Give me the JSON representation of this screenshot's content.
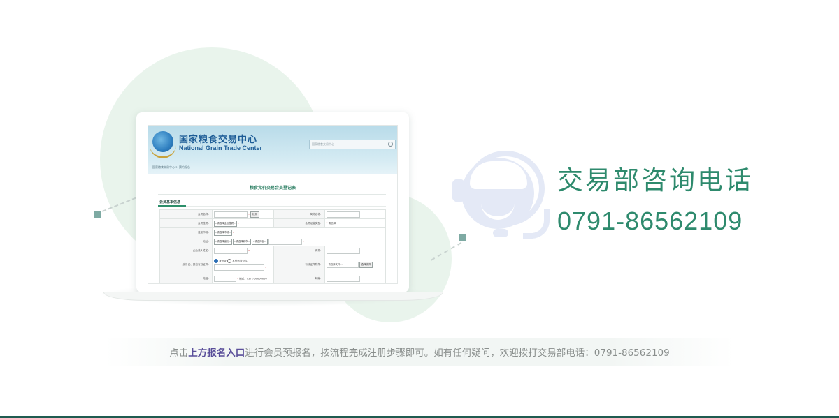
{
  "screen": {
    "logo_cn": "国家粮食交易中心",
    "logo_en": "National Grain Trade Center",
    "search_placeholder": "国家粮食交易中心",
    "breadcrumb": "国家粮食交易中心 > 预约报名",
    "form_title": "粮食竞价交易会员登记表",
    "section_title": "会员基本信息",
    "rows": {
      "member_name_label": "会员名称：",
      "check_button": "检测",
      "abbr_label": "简称名称：",
      "member_type_label": "会员性质：",
      "member_type_select": "--请选择企业性质--",
      "business_type_label": "会员经营类型：",
      "business_type_value": "请选择",
      "reg_market_label": "注册市场：",
      "reg_market_select": "--请选择市场--",
      "address_label": "地址：",
      "province_select": "--请选择省份--",
      "city_select": "--请选择城市--",
      "district_select": "--请选择区--",
      "legal_rep_label": "企业法人姓名：",
      "fax_label": "传真：",
      "id_label": "身份证、其他有效证件：",
      "id_radio_1": "身份证",
      "id_radio_2": "其他有效证件",
      "id_attach_label": "有效证件附件：",
      "file_placeholder": "请选择文件...",
      "file_button": "选择文件",
      "phone_label": "电话：",
      "phone_hint": "格式：0371-66666666",
      "postcode_label": "邮编："
    },
    "required_mark": "*"
  },
  "contact": {
    "title": "交易部咨询电话",
    "phone": "0791-86562109"
  },
  "notice": {
    "prefix": "点击",
    "highlight": "上方报名入口",
    "suffix": "进行会员预报名，按流程完成注册步骤即可。如有任何疑问，欢迎拨打交易部电话：0791-86562109"
  },
  "colors": {
    "accent_green": "#2e8a6d",
    "highlight_purple": "#5a4f9a",
    "footer_line": "#1f5b50"
  },
  "icons": [
    "headset-support-icon",
    "search-icon"
  ]
}
